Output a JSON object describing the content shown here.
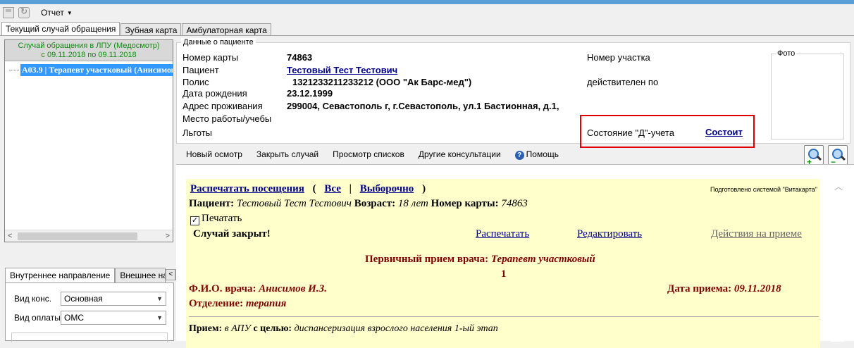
{
  "toolbar": {
    "report_menu": "Отчет"
  },
  "top_tabs": [
    "Текущий случай обращения",
    "Зубная карта",
    "Амбулаторная карта"
  ],
  "left": {
    "header_line1": "Случай обращения в ЛПУ (Медосмотр)",
    "header_line2": "с 09.11.2018 по 09.11.2018",
    "tree_item": "А03.9 | Терапевт участковый (Анисимов"
  },
  "direction_tabs": {
    "internal": "Внутреннее направление",
    "external": "Внешнее на"
  },
  "direction_form": {
    "kind_label": "Вид конс.",
    "kind_value": "Основная",
    "pay_label": "Вид оплаты",
    "pay_value": "ОМС"
  },
  "patient": {
    "group_title": "Данные о пациенте",
    "card_label": "Номер карты",
    "card_value": "74863",
    "patient_label": "Пациент",
    "patient_value": "Тестовый Тест Тестович",
    "policy_label": "Полис",
    "policy_value": "1321233211233212 (ООО \"Ак Барс-мед\")",
    "birth_label": "Дата рождения",
    "birth_value": "23.12.1999",
    "address_label": "Адрес проживания",
    "address_value": "299004, Севастополь г, г.Севастополь, ул.1 Бастионная, д.1,",
    "work_label": "Место работы/учебы",
    "benefits_label": "Льготы",
    "district_label": "Номер участка",
    "valid_label": "действителен по",
    "photo_title": "Фото",
    "d_status_label": "Состояние \"Д\"-учета",
    "d_status_value": "Состоит"
  },
  "actions": {
    "new_exam": "Новый осмотр",
    "close_case": "Закрыть случай",
    "view_lists": "Просмотр списков",
    "other_consult": "Другие консультации",
    "help": "Помощь"
  },
  "document": {
    "print_visits": "Распечатать посещения",
    "open_paren": "(",
    "all": "Все",
    "sep": "|",
    "selective": "Выборочно",
    "close_paren": ")",
    "prepared_by": "Подготовлено системой \"Витакарта\"",
    "patient_label": "Пациент:",
    "patient_value": "Тестовый Тест Тестович",
    "age_label": "Возраст:",
    "age_value": "18 лет",
    "card_label": "Номер карты:",
    "card_value": "74863",
    "print_checkbox": "Печатать",
    "case_closed": "Случай закрыт!",
    "print_link": "Распечатать",
    "edit_link": "Редактировать",
    "actions_link": "Действия на приеме",
    "visit_title": "Первичный прием врача:",
    "visit_specialty": "Терапевт участковый",
    "visit_number": "1",
    "doctor_label": "Ф.И.О. врача:",
    "doctor_value": "Анисимов И.З.",
    "date_label": "Дата приема:",
    "date_value": "09.11.2018",
    "dept_label": "Отделение:",
    "dept_value": "терапия",
    "reception_label": "Прием:",
    "reception_place": "в АПУ",
    "purpose_label": "с целью:",
    "purpose_value": "диспансеризация взрослого населения 1-ый этап"
  }
}
